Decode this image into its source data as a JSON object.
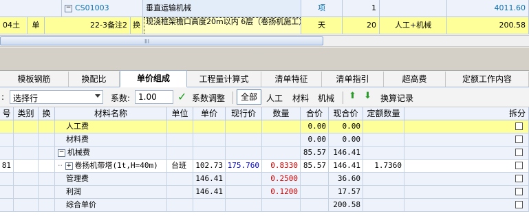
{
  "top_grid": {
    "row1": {
      "code": "CS01003",
      "name": "垂直运输机械",
      "unit": "项",
      "qty": "1",
      "amount": "4011.60"
    },
    "row2": {
      "num": "04土",
      "kind": "单",
      "code": "22-3备注2",
      "swap": "换",
      "name": "现浇框架檐口高度20m以内 6层（卷扬机施工）",
      "unit": "天",
      "qty": "20",
      "spec": "人工+机械",
      "amount": "200.58"
    }
  },
  "scrollbar": {
    "grip": "III"
  },
  "tabs": [
    "模板钢筋",
    "换配比",
    "单价组成",
    "工程量计算式",
    "清单特征",
    "清单指引",
    "超高费",
    "定额工作内容"
  ],
  "active_tab": "单价组成",
  "toolbar": {
    "colon": ":",
    "select_value": "选择行",
    "coef_label": "系数:",
    "coef_value": "1.00",
    "adjust_label": "系数调整",
    "all_label": "全部",
    "labor_label": "人工",
    "material_label": "材料",
    "machine_label": "机械",
    "calc_record_label": "换算记录"
  },
  "columns": [
    "号",
    "类别",
    "换",
    "材料名称",
    "单位",
    "单价",
    "现行价",
    "数量",
    "合价",
    "现合价",
    "定额数量",
    "拆分"
  ],
  "rows": [
    {
      "no": "",
      "name": "人工费",
      "unit": "",
      "price": "",
      "cur_price": "",
      "qty": "",
      "total": "0.00",
      "cur_total": "0.00",
      "quota_qty": "",
      "highlight": true
    },
    {
      "no": "",
      "name": "材料费",
      "unit": "",
      "price": "",
      "cur_price": "",
      "qty": "",
      "total": "0.00",
      "cur_total": "0.00",
      "quota_qty": ""
    },
    {
      "no": "",
      "name": "机械费",
      "unit": "",
      "price": "",
      "cur_price": "",
      "qty": "",
      "total": "85.57",
      "cur_total": "146.41",
      "quota_qty": ""
    },
    {
      "no": "81",
      "name": "卷扬机带塔(1t,H=40m)",
      "unit": "台班",
      "price": "102.73",
      "cur_price": "175.760",
      "qty": "0.8330",
      "total": "85.57",
      "cur_total": "146.41",
      "quota_qty": "1.7360",
      "white": true
    },
    {
      "no": "",
      "name": "管理费",
      "unit": "",
      "price": "146.41",
      "cur_price": "",
      "qty": "0.2500",
      "total": "",
      "cur_total": "36.60",
      "quota_qty": ""
    },
    {
      "no": "",
      "name": "利润",
      "unit": "",
      "price": "146.41",
      "cur_price": "",
      "qty": "0.1200",
      "total": "",
      "cur_total": "17.57",
      "quota_qty": ""
    },
    {
      "no": "",
      "name": "综合单价",
      "unit": "",
      "price": "",
      "cur_price": "",
      "qty": "",
      "total": "",
      "cur_total": "200.58",
      "quota_qty": ""
    }
  ]
}
